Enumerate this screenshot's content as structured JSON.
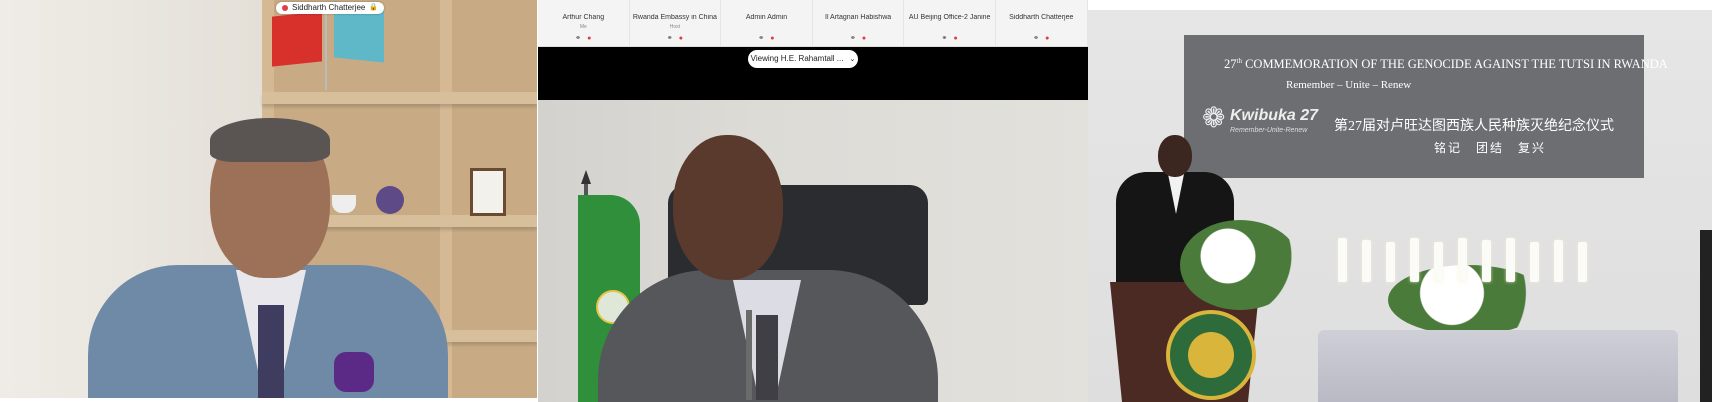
{
  "left_panel": {
    "name_tag": "Siddharth Chatterjee"
  },
  "middle_panel": {
    "participants": [
      {
        "name": "Arthur Chang",
        "role": "Me"
      },
      {
        "name": "Rwanda Embassy in China",
        "role": "Host"
      },
      {
        "name": "Admin Admin",
        "role": ""
      },
      {
        "name": "Il Artagnan Habishwa",
        "role": ""
      },
      {
        "name": "AU Beijing Office-2 Janine",
        "role": ""
      },
      {
        "name": "Siddharth Chatterjee",
        "role": ""
      }
    ],
    "viewing_label": "Viewing H.E. Rahamtall ..."
  },
  "right_panel": {
    "banner": {
      "ordinal": "27",
      "ordinal_suffix": "th",
      "title_rest": " COMMEMORATION OF THE GENOCIDE AGAINST THE TUTSI IN RWANDA",
      "motto": "Remember – Unite – Renew",
      "brand": "Kwibuka 27",
      "brand_sub": "Remember-Unite-Renew",
      "cn_title": "第27届对卢旺达图西族人民种族灭绝纪念仪式",
      "cn_motto": "铭记　团结　复兴"
    }
  },
  "colors": {
    "au_flag_green": "#2f8f3a",
    "banner_gray": "#6c6e71",
    "mic_muted_red": "#e03b3b"
  }
}
